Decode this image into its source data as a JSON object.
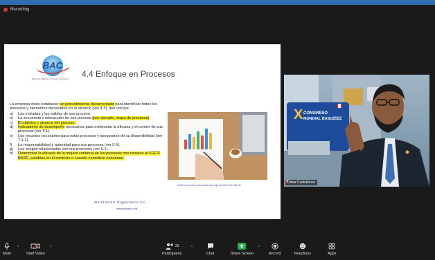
{
  "recording": {
    "label": "Recording",
    "color": "#e0352f"
  },
  "slide": {
    "logo_text": "BAC",
    "logo_tagline": "Business Alliance for Secure Commerce",
    "title": "4.4 Enfoque en Procesos",
    "intro": "La empresa debe establecer",
    "intro_highlight": "un procedimiento documentado",
    "intro_rest": "para identificar todos los procesos y elementos declarados en el alcance (ver 4.3), que incluya:",
    "items": [
      {
        "letter": "a)",
        "pre": "Las entradas y las salidas de sus proceso.",
        "hl": "",
        "post": ""
      },
      {
        "letter": "b)",
        "pre": "La secuencia e interacción de sus proceso",
        "hl": "(por ejemplo, mapa de procesos)",
        "post": "."
      },
      {
        "letter": "c)",
        "pre": "",
        "hl": "El objetivo y alcance del proceso.",
        "post": ""
      },
      {
        "letter": "d)",
        "pre": "",
        "hl": "Indicadores de desempeño",
        "post": "necesarios para evidenciar la eficacia y el control de sus procesos (ver 5.1)."
      },
      {
        "letter": "e)",
        "pre": "Los recursos necesarios para estos procesos y asegurarse de su disponibilidad (ver 7.1.1).",
        "hl": "",
        "post": ""
      },
      {
        "letter": "f)",
        "pre": "La responsabilidad y autoridad para sus procesos (ver 5.4).",
        "hl": "",
        "post": ""
      },
      {
        "letter": "g)",
        "pre": "Los riesgos relacionados con sus procesos (ver 6.1).",
        "hl": "",
        "post": ""
      },
      {
        "letter": "h)",
        "pre": "",
        "hl": "Determinar la eficacia de la mejora continua de los procesos con relación al SGCS BASC, cambios en el contexto o cuando considere necesario.",
        "post": ""
      }
    ],
    "photo_caption": "Esta Foto de Autor desconocido está bajo licencia CC BY-SA-NC",
    "footer_org": "World BASC Organization Inc.",
    "footer_url": "www.wbasco.org"
  },
  "speaker": {
    "name": "Omar Castellanos",
    "banner_line1": "CONGRESO",
    "banner_line2": "MUNDIAL BASC",
    "banner_year": "2022",
    "banner_city": "LIMA - PERÚ"
  },
  "toolbar": {
    "mute": "Mute",
    "start_video": "Start Video",
    "participants": "Participants",
    "participants_count": "33",
    "chat": "Chat",
    "share_screen": "Share Screen",
    "record": "Record",
    "reactions": "Reactions",
    "apps": "Apps"
  },
  "colors": {
    "frame": "#2f6db5",
    "highlight": "#f6ef2a",
    "share_green": "#23b04a"
  }
}
